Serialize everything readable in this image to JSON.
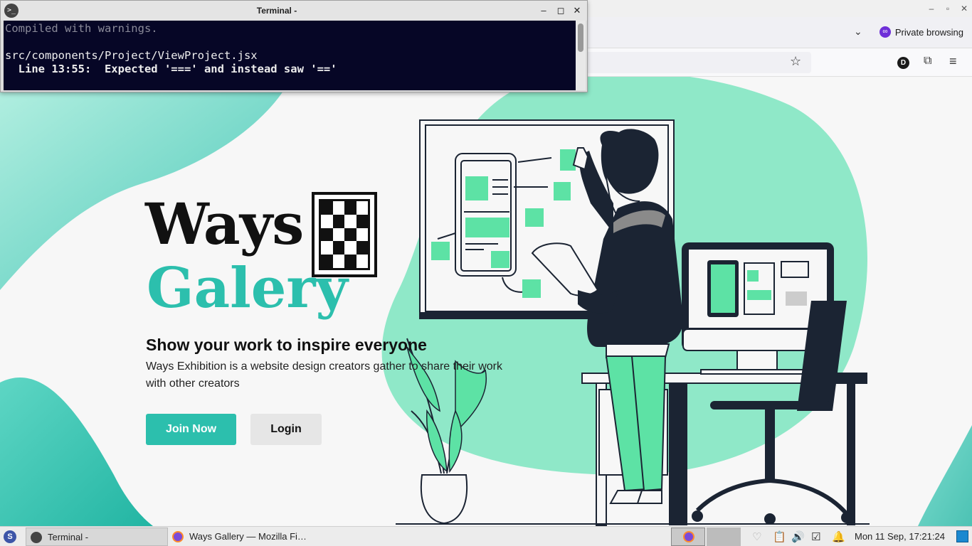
{
  "terminal": {
    "title": "Terminal -",
    "lines": [
      "Compiled with warnings.",
      "",
      "src/components/Project/ViewProject.jsx",
      "  Line 13:55:  Expected '===' and instead saw '=='"
    ]
  },
  "browser": {
    "private_label": "Private browsing",
    "profile_initial": "D"
  },
  "page": {
    "brand_word1": "Ways",
    "brand_word2": "Galery",
    "headline": "Show your work to inspire everyone",
    "subtext": "Ways Exhibition is a website design creators gather to share their work with other creators",
    "join_label": "Join Now",
    "login_label": "Login"
  },
  "taskbar": {
    "items": [
      {
        "label": "Terminal -",
        "icon": "terminal-icon"
      },
      {
        "label": "Ways Gallery — Mozilla Fi…",
        "icon": "firefox-icon"
      }
    ],
    "clock": "Mon 11 Sep, 17:21:24"
  },
  "colors": {
    "accent": "#2cbfad",
    "mint": "#8fe8c8",
    "dark": "#1b2433",
    "terminal_bg": "#060626"
  }
}
